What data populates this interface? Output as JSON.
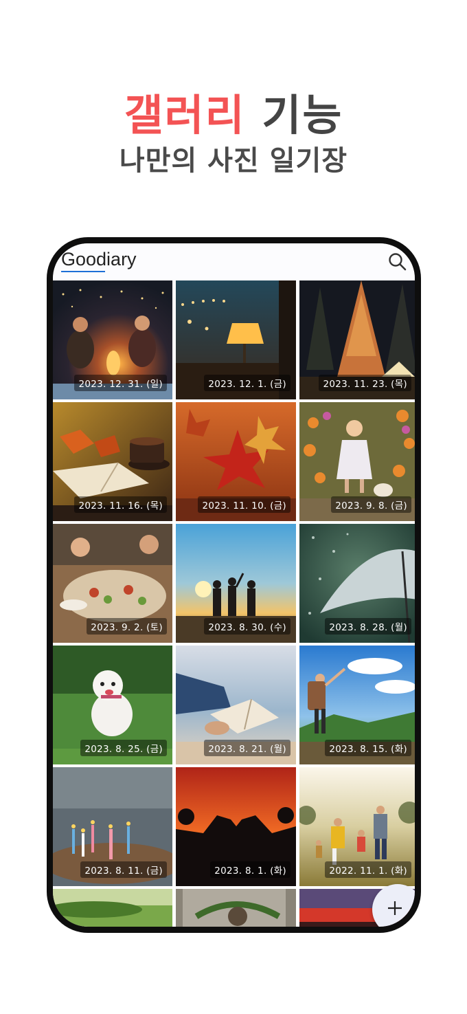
{
  "promo": {
    "headline_accent": "갤러리",
    "headline_rest": "기능",
    "subheadline": "나만의 사진 일기장",
    "accent_color": "#f35354"
  },
  "app": {
    "title": "Goodiary",
    "search_icon": "search-icon",
    "fab_icon": "plus-icon"
  },
  "gallery": {
    "items": [
      {
        "date": "2023. 12. 31. (일)",
        "scene": "campfire-friends"
      },
      {
        "date": "2023. 12. 1. (금)",
        "scene": "cafe-lamp"
      },
      {
        "date": "2023. 11. 23. (목)",
        "scene": "forest-tent-night"
      },
      {
        "date": "2023. 11. 16. (목)",
        "scene": "book-coffee-leaves"
      },
      {
        "date": "2023. 11. 10. (금)",
        "scene": "maple-leaves"
      },
      {
        "date": "2023. 9. 8. (금)",
        "scene": "girl-flowers-dog"
      },
      {
        "date": "2023. 9. 2. (토)",
        "scene": "dinner-table"
      },
      {
        "date": "2023. 8. 30. (수)",
        "scene": "sunset-friends"
      },
      {
        "date": "2023. 8. 28. (월)",
        "scene": "umbrella-rain"
      },
      {
        "date": "2023. 8. 25. (금)",
        "scene": "white-dog-grass"
      },
      {
        "date": "2023. 8. 21. (월)",
        "scene": "reading-beach"
      },
      {
        "date": "2023. 8. 15. (화)",
        "scene": "hiker-mountain"
      },
      {
        "date": "2023. 8. 11. (금)",
        "scene": "birthday-candles"
      },
      {
        "date": "2023. 8. 1. (화)",
        "scene": "heart-hands-sunset"
      },
      {
        "date": "2022. 11. 1. (화)",
        "scene": "family-walk-field"
      },
      {
        "date": "",
        "scene": "green-park"
      },
      {
        "date": "",
        "scene": "stone-wreath"
      },
      {
        "date": "",
        "scene": "red-sky"
      }
    ]
  }
}
